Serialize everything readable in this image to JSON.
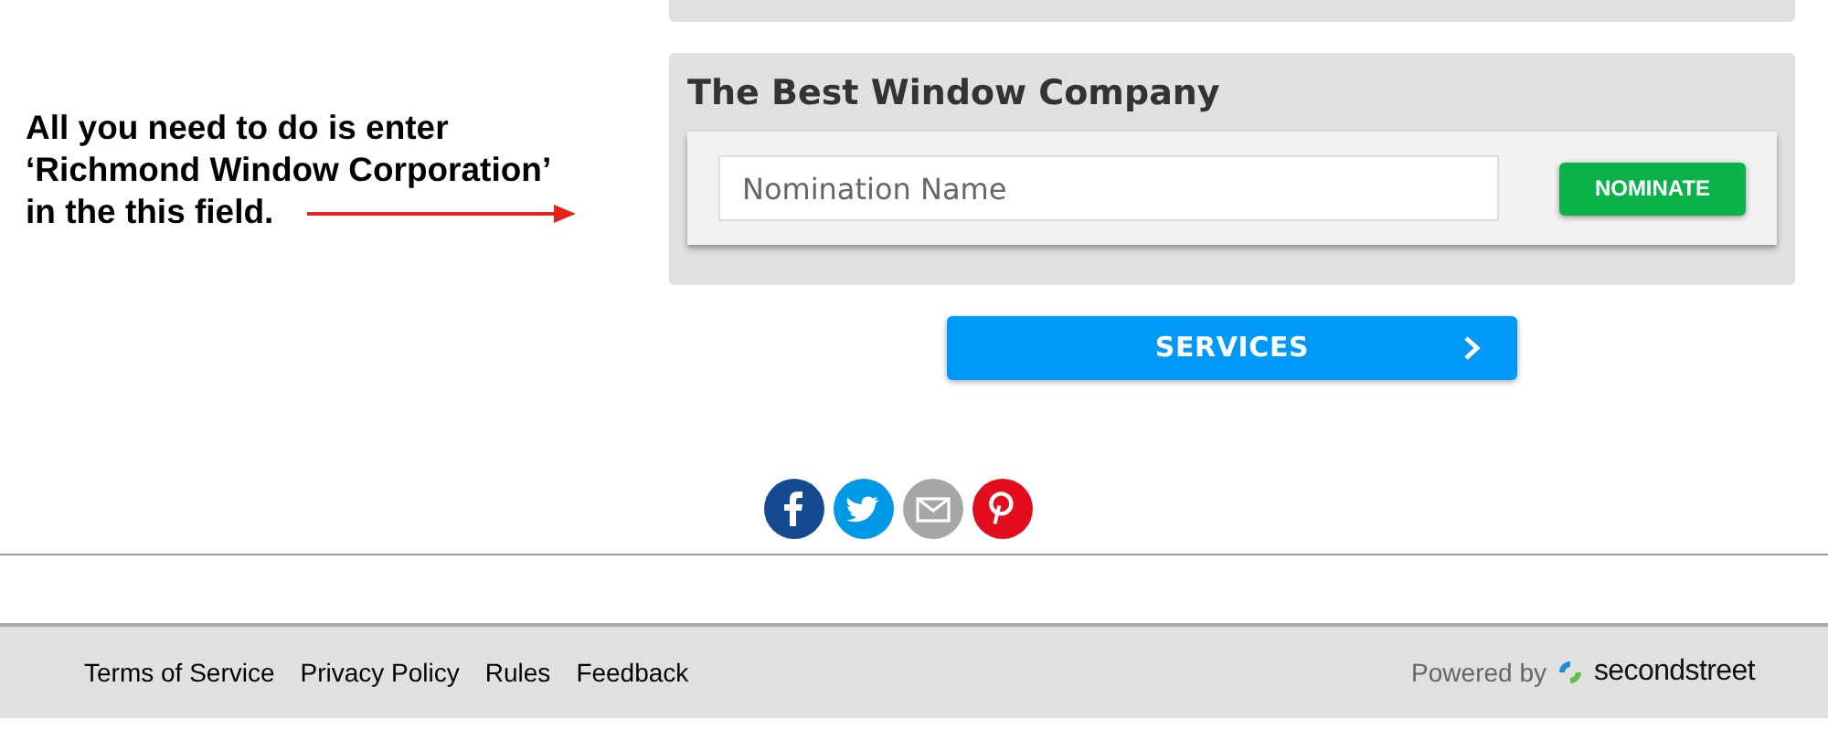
{
  "annotation": {
    "lines": [
      "All you need to do is enter",
      "‘Richmond Window Corporation’",
      "in the this field."
    ]
  },
  "category": {
    "title": "The Best Window Company",
    "field": {
      "placeholder": "Nomination Name"
    },
    "button": "NOMINATE"
  },
  "services_button": {
    "label": "SERVICES"
  },
  "share": [
    {
      "kind": "facebook"
    },
    {
      "kind": "twitter"
    },
    {
      "kind": "email"
    },
    {
      "kind": "pinterest"
    }
  ],
  "footer": {
    "links": [
      "Terms of Service",
      "Privacy Policy",
      "Rules",
      "Feedback"
    ],
    "powered_by": "Powered by",
    "brand": "secondstreet"
  }
}
